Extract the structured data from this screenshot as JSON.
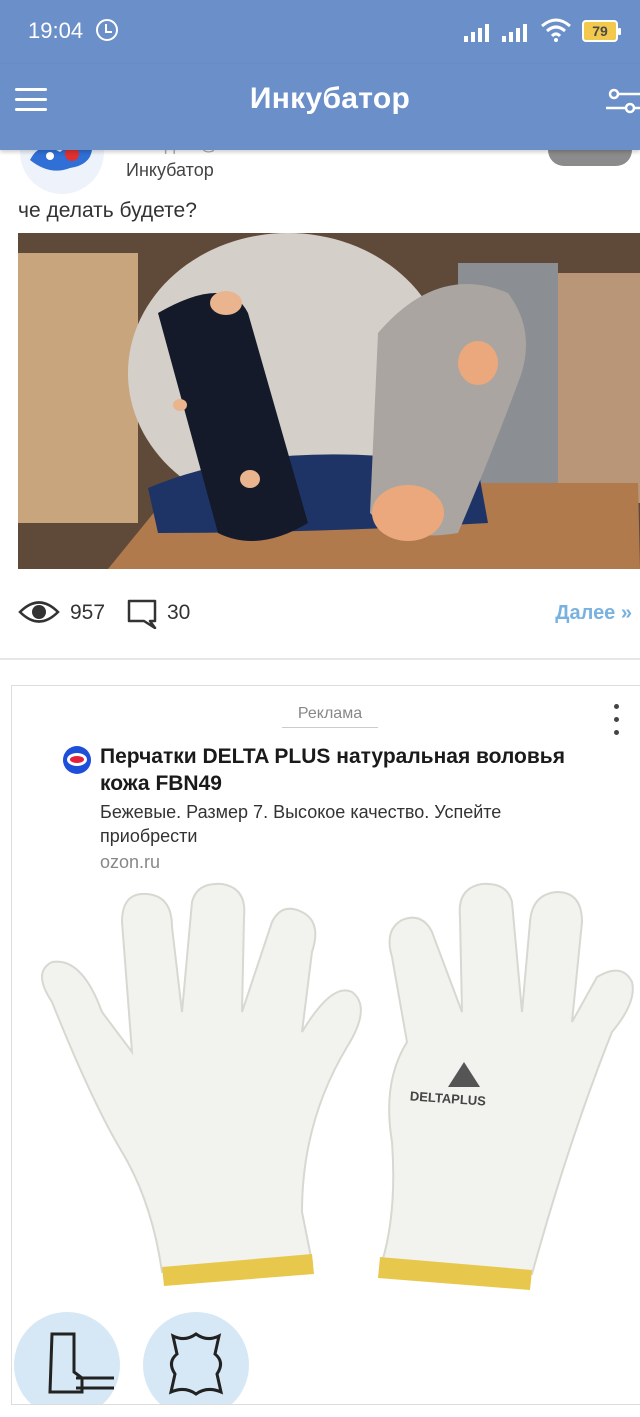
{
  "status_bar": {
    "time": "19:04",
    "battery": "79"
  },
  "app_bar": {
    "title": "Инкубатор"
  },
  "post": {
    "community": "Инкубатор",
    "author_partial": "Сегодня @ ПРНТ",
    "text": "че делать будете?",
    "views": "957",
    "comments": "30",
    "more_link": "Далее »"
  },
  "ad": {
    "label": "Реклама",
    "title": "Перчатки DELTA PLUS натуральная воловья кожа FBN49",
    "description": "Бежевые. Размер 7. Высокое качество. Успейте приобрести",
    "domain": "ozon.ru",
    "glove_brand": "DELTAPLUS"
  },
  "colors": {
    "app_bar": "#6a8fc9",
    "link": "#79b2e0",
    "battery": "#f2c94c"
  }
}
